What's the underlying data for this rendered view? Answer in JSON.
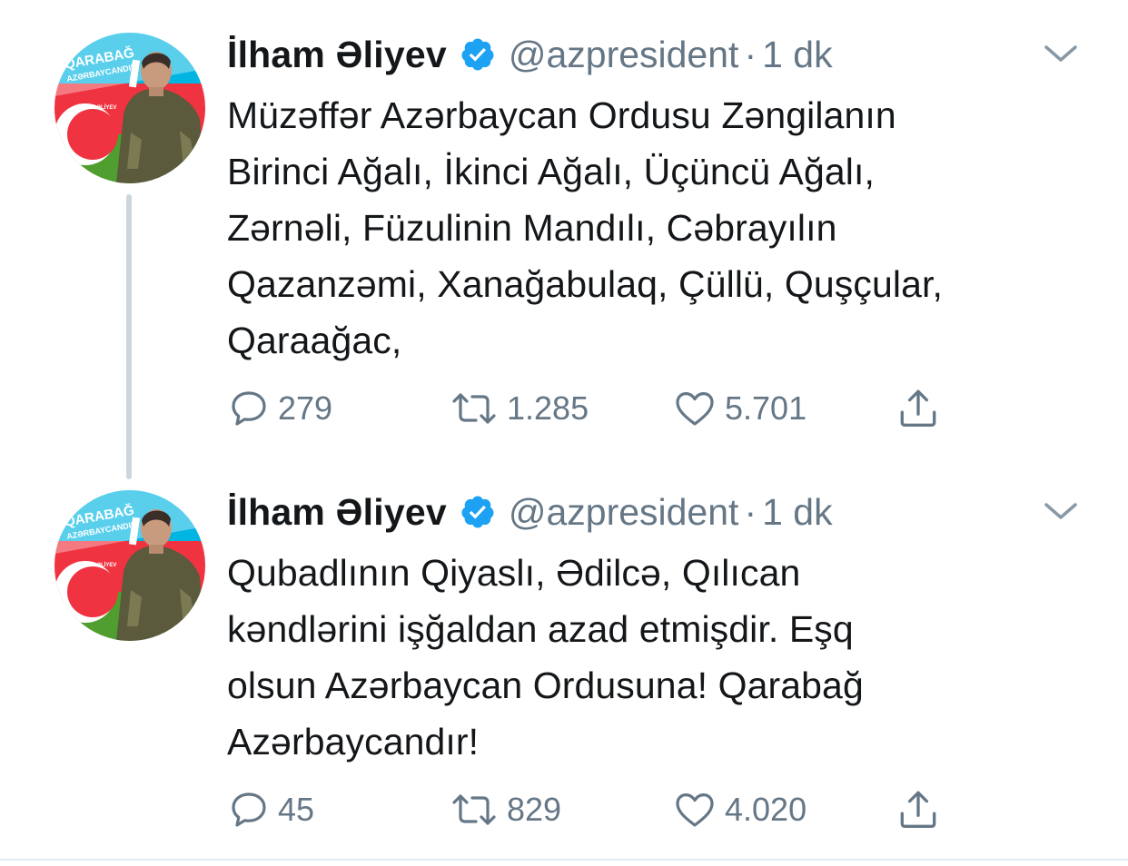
{
  "tweets": [
    {
      "author": {
        "name": "İlham Əliyev",
        "handle": "@azpresident",
        "verified": true,
        "avatar_text_top": "QARABAĞ",
        "avatar_text_bottom": "AZƏRBAYCANDIR",
        "avatar_name": "İLHAM ƏLİYEV"
      },
      "separator": "·",
      "time": "1 dk",
      "text_lines": [
        "Müzəffər Azərbaycan Ordusu Zəngilanın",
        "Birinci Ağalı, İkinci Ağalı, Üçüncü Ağalı,",
        "Zərnəli, Füzulinin Mandılı, Cəbrayılın",
        "Qazanzəmi, Xanağabulaq, Çüllü, Quşçular,",
        "Qaraağac,"
      ],
      "stats": {
        "replies": "279",
        "retweets": "1.285",
        "likes": "5.701"
      }
    },
    {
      "author": {
        "name": "İlham Əliyev",
        "handle": "@azpresident",
        "verified": true,
        "avatar_text_top": "QARABAĞ",
        "avatar_text_bottom": "AZƏRBAYCANDIR",
        "avatar_name": "İLHAM ƏLİYEV"
      },
      "separator": "·",
      "time": "1 dk",
      "text_lines": [
        "Qubadlının Qiyaslı, Ədilcə, Qılıcan",
        "kəndlərini işğaldan azad etmişdir. Eşq",
        "olsun Azərbaycan Ordusuna! Qarabağ",
        "Azərbaycandır!"
      ],
      "stats": {
        "replies": "45",
        "retweets": "829",
        "likes": "4.020"
      }
    }
  ],
  "icons": {
    "verified": "verified-badge-icon",
    "caret": "chevron-down-icon",
    "reply": "reply-icon",
    "retweet": "retweet-icon",
    "like": "heart-icon",
    "share": "share-icon"
  },
  "colors": {
    "text": "#14171a",
    "secondary": "#657786",
    "verified": "#1da1f2",
    "thread_line": "#ccd6dd",
    "flag_blue": "#00b5e2",
    "flag_red": "#ef3340",
    "flag_green": "#509e2f"
  }
}
